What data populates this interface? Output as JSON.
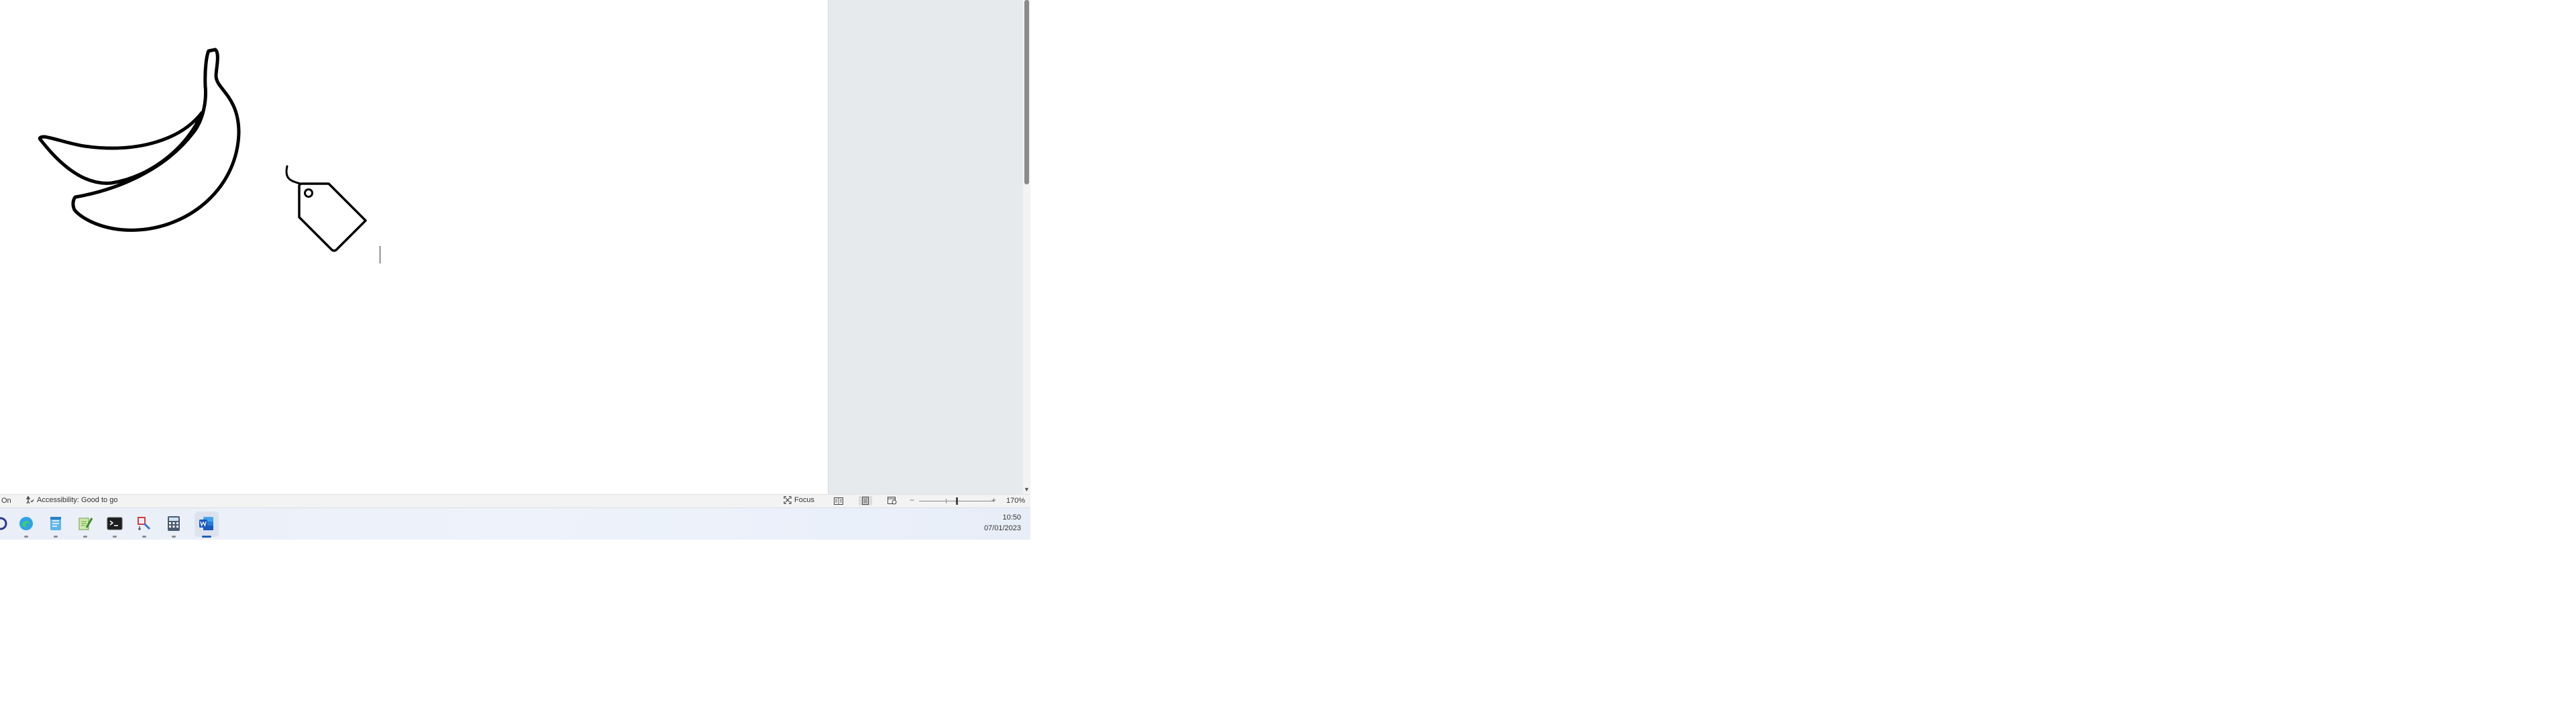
{
  "status_bar": {
    "left_text": "On",
    "accessibility": "Accessibility: Good to go",
    "focus": "Focus",
    "zoom_out": "−",
    "zoom_in": "+",
    "zoom_level": "170%",
    "zoom_fraction": 0.5
  },
  "document": {
    "shapes": [
      "banana-icon",
      "price-tag-icon"
    ]
  },
  "taskbar": {
    "apps": [
      "cortana",
      "edge",
      "notepad",
      "notepad-plus",
      "terminal",
      "paint",
      "calculator",
      "word"
    ],
    "active_app": "word"
  },
  "clock": {
    "time": "10:50",
    "date": "07/01/2023"
  },
  "colors": {
    "gutter": "#e7eaed",
    "taskbar": "#eef3fb",
    "word_blue": "#185abd"
  }
}
